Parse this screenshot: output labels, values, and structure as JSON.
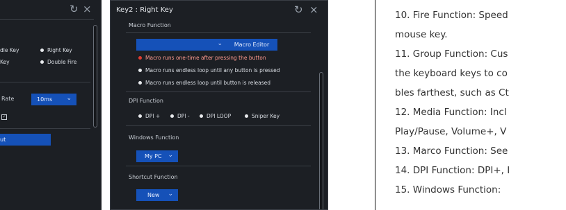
{
  "left_panel": {
    "titlebar_icons": {
      "refresh": "↻",
      "close": "×"
    },
    "options_row1": [
      "dle Key",
      "Right Key"
    ],
    "options_row2": [
      "Key",
      "Double Fire"
    ],
    "rate_label": "Rate",
    "rate_value": "10ms",
    "shortcut_fragment": "ut"
  },
  "main_panel": {
    "title": "Key2 : Right Key",
    "titlebar_icons": {
      "refresh": "↻",
      "close": "×"
    },
    "macro": {
      "label": "Macro Function",
      "select_value": "",
      "editor_button": "Macro Editor",
      "options": [
        {
          "text": "Macro runs one-time after pressing the button",
          "selected": true
        },
        {
          "text": "Macro runs endless loop until any button is pressed",
          "selected": false
        },
        {
          "text": "Macro runs endless loop until button is released",
          "selected": false
        }
      ]
    },
    "dpi": {
      "label": "DPI Function",
      "options": [
        "DPI +",
        "DPI -",
        "DPI LOOP",
        "Sniper Key"
      ]
    },
    "windows": {
      "label": "Windows Function",
      "select_value": "My PC"
    },
    "shortcut": {
      "label": "Shortcut Function",
      "select_value": "New"
    }
  },
  "manual_text": {
    "lines": [
      "10. Fire Function: Speed",
      "mouse key.",
      "11. Group Function: Cus",
      "the keyboard keys to co",
      "bles farthest, such as Ct",
      "12. Media Function: Incl",
      "Play/Pause, Volume+, V",
      "13. Marco Function: See",
      "14. DPI Function: DPI+, I",
      "15.  Windows Function:"
    ]
  },
  "colors": {
    "panel_bg": "#1c1f24",
    "accent_blue": "#1551b8",
    "selected_red": "#e03c31"
  }
}
